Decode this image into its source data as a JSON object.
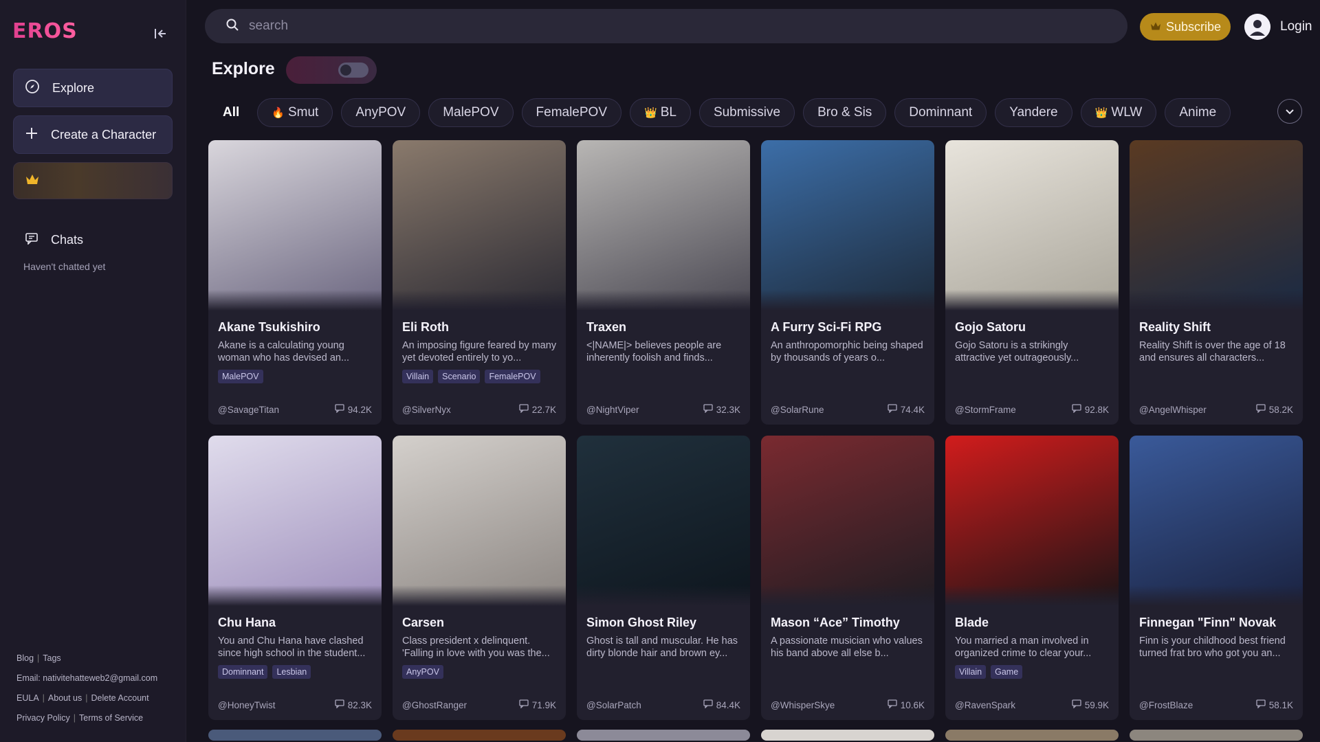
{
  "app": {
    "logo_text": "EROS"
  },
  "sidebar": {
    "explore_label": "Explore",
    "create_label": "Create a Character",
    "chats_label": "Chats",
    "chats_empty": "Haven't chatted yet",
    "footer": {
      "blog": "Blog",
      "tags": "Tags",
      "email": "Email: nativitehatteweb2@gmail.com",
      "eula": "EULA",
      "about": "About us",
      "delete": "Delete Account",
      "privacy": "Privacy Policy",
      "terms": "Terms of Service"
    }
  },
  "header": {
    "search_placeholder": "search",
    "subscribe_label": "Subscribe",
    "login_label": "Login"
  },
  "explore": {
    "title": "Explore",
    "tags": [
      {
        "label": "All",
        "emoji": ""
      },
      {
        "label": "Smut",
        "emoji": "🔥"
      },
      {
        "label": "AnyPOV",
        "emoji": ""
      },
      {
        "label": "MalePOV",
        "emoji": ""
      },
      {
        "label": "FemalePOV",
        "emoji": ""
      },
      {
        "label": "BL",
        "emoji": "👑"
      },
      {
        "label": "Submissive",
        "emoji": ""
      },
      {
        "label": "Bro & Sis",
        "emoji": ""
      },
      {
        "label": "Dominnant",
        "emoji": ""
      },
      {
        "label": "Yandere",
        "emoji": ""
      },
      {
        "label": "WLW",
        "emoji": "👑"
      },
      {
        "label": "Anime",
        "emoji": ""
      }
    ]
  },
  "cards": [
    {
      "name": "Akane Tsukishiro",
      "desc": "Akane is a calculating young woman who has devised an...",
      "badges": [
        "MalePOV"
      ],
      "author": "@SavageTitan",
      "count": "94.2K",
      "colors": [
        "#d9d6dc",
        "#6b6680"
      ]
    },
    {
      "name": "Eli Roth",
      "desc": "An imposing figure feared by many yet devoted entirely to yo...",
      "badges": [
        "Villain",
        "Scenario",
        "FemalePOV"
      ],
      "author": "@SilverNyx",
      "count": "22.7K",
      "colors": [
        "#8a7a6c",
        "#2b2a33"
      ]
    },
    {
      "name": "Traxen",
      "desc": "<|NAME|> believes people are inherently foolish and finds...",
      "badges": [],
      "author": "@NightViper",
      "count": "32.3K",
      "colors": [
        "#b8b6b4",
        "#4a4852"
      ]
    },
    {
      "name": "A Furry Sci-Fi RPG",
      "desc": "An anthropomorphic being shaped by thousands of years o...",
      "badges": [],
      "author": "@SolarRune",
      "count": "74.4K",
      "colors": [
        "#3c6ea8",
        "#1d2a3a"
      ]
    },
    {
      "name": "Gojo Satoru",
      "desc": "Gojo Satoru is a strikingly attractive yet outrageously...",
      "badges": [],
      "author": "@StormFrame",
      "count": "92.8K",
      "colors": [
        "#e8e4dc",
        "#a9a59a"
      ]
    },
    {
      "name": "Reality Shift",
      "desc": "Reality Shift is over the age of 18 and ensures all characters...",
      "badges": [],
      "author": "@AngelWhisper",
      "count": "58.2K",
      "colors": [
        "#5a3a22",
        "#1a2a44"
      ]
    },
    {
      "name": "Chu Hana",
      "desc": "You and Chu Hana have clashed since high school in the student...",
      "badges": [
        "Dominnant",
        "Lesbian"
      ],
      "author": "@HoneyTwist",
      "count": "82.3K",
      "colors": [
        "#e0dcec",
        "#9e8fbc"
      ]
    },
    {
      "name": "Carsen",
      "desc": "Class president x delinquent. 'Falling in love with you was the...",
      "badges": [
        "AnyPOV"
      ],
      "author": "@GhostRanger",
      "count": "71.9K",
      "colors": [
        "#d4d0cc",
        "#8c8682"
      ]
    },
    {
      "name": "Simon Ghost Riley",
      "desc": "Ghost is tall and muscular. He has dirty blonde hair and brown ey...",
      "badges": [],
      "author": "@SolarPatch",
      "count": "84.4K",
      "colors": [
        "#20303c",
        "#0e161e"
      ]
    },
    {
      "name": "Mason “Ace” Timothy",
      "desc": "A passionate musician who values his band above all else b...",
      "badges": [],
      "author": "@WhisperSkye",
      "count": "10.6K",
      "colors": [
        "#7a2a30",
        "#1e1c22"
      ]
    },
    {
      "name": "Blade",
      "desc": "You married a man involved in organized crime to clear your...",
      "badges": [
        "Villain",
        "Game"
      ],
      "author": "@RavenSpark",
      "count": "59.9K",
      "colors": [
        "#d21c1c",
        "#1a1416"
      ]
    },
    {
      "name": "Finnegan \"Finn\" Novak",
      "desc": "Finn is your childhood best friend turned frat bro who got you an...",
      "badges": [],
      "author": "@FrostBlaze",
      "count": "58.1K",
      "colors": [
        "#3a5a9a",
        "#1a2240"
      ]
    }
  ]
}
